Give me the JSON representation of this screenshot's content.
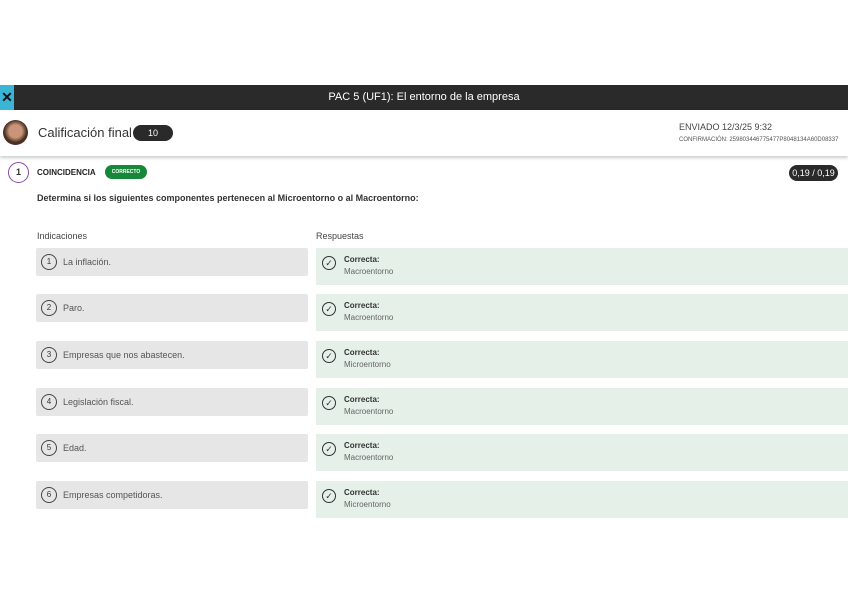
{
  "topbar": {
    "title": "PAC 5 (UF1): El entorno de la empresa",
    "close": "✕"
  },
  "header": {
    "grade_label": "Calificación final",
    "grade": "10",
    "sent": "ENVIADO 12/3/25 9:32",
    "confirmation": "CONFIRMACIÓN: 259803446775477P8048134A60D08337"
  },
  "question": {
    "number": "1",
    "type": "COINCIDENCIA",
    "status": "CORRECTO",
    "score": "0,19 / 0,19",
    "instruction": "Determina si los siguientes componentes pertenecen al Microentorno o al Macroentorno:"
  },
  "columns": {
    "left": "Indicaciones",
    "right": "Respuestas"
  },
  "rows": [
    {
      "n": "1",
      "prompt": "La inflación.",
      "result": "Correcta:",
      "answer": "Macroentorno"
    },
    {
      "n": "2",
      "prompt": "Paro.",
      "result": "Correcta:",
      "answer": "Macroentorno"
    },
    {
      "n": "3",
      "prompt": "Empresas que nos abastecen.",
      "result": "Correcta:",
      "answer": "Microentorno"
    },
    {
      "n": "4",
      "prompt": "Legislación fiscal.",
      "result": "Correcta:",
      "answer": "Macroentorno"
    },
    {
      "n": "5",
      "prompt": "Edad.",
      "result": "Correcta:",
      "answer": "Macroentorno"
    },
    {
      "n": "6",
      "prompt": "Empresas competidoras.",
      "result": "Correcta:",
      "answer": "Microentorno"
    }
  ]
}
